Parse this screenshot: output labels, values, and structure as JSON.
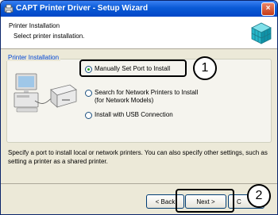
{
  "window": {
    "title": "CAPT Printer Driver - Setup Wizard",
    "close_label": "×"
  },
  "header": {
    "title": "Printer Installation",
    "subtitle": "Select printer installation."
  },
  "group": {
    "label": "Printer Installation",
    "options": [
      {
        "label": "Manually Set Port to Install",
        "selected": true
      },
      {
        "label_line1": "Search for Network Printers to Install",
        "label_line2": "(for Network Models)",
        "selected": false
      },
      {
        "label": "Install with USB Connection",
        "selected": false
      }
    ]
  },
  "description": "Specify a port to install local or network printers. You can also specify other settings, such as setting a printer as a shared printer.",
  "buttons": {
    "back": "< Back",
    "next": "Next >",
    "cancel": "C"
  },
  "annotations": {
    "badge1": "1",
    "badge2": "2"
  }
}
